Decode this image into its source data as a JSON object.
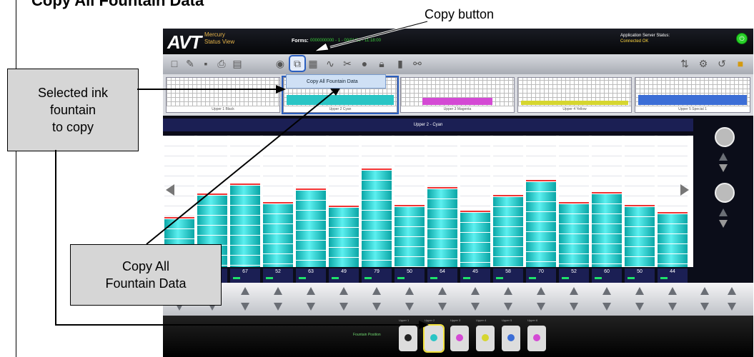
{
  "doc": {
    "title": "Copy All Fountain Data",
    "copy_button_caption": "Copy button",
    "callout_selected": [
      "Selected ink",
      "fountain",
      "to copy"
    ],
    "callout_copy_all": [
      "Copy All",
      "Fountain Data"
    ]
  },
  "app": {
    "logo": "AVT",
    "app_name": [
      "Mercury",
      "Status View"
    ],
    "forms_label": "Forms:",
    "forms_value": "0000000000 - 1 - 00/01/26 - 11:18:00",
    "server_status_label": "Application Server Status:",
    "server_status_value": "Connected OK",
    "toolbar_icons": [
      "new-icon",
      "edit-icon",
      "save-icon",
      "print-icon",
      "open-icon",
      "globe-icon",
      "copy-icon",
      "paste-icon",
      "curve-icon",
      "tools-icon",
      "color-icon",
      "lock-icon",
      "chart-icon",
      "link-icon",
      "scale-icon",
      "adjust-icon",
      "reset-icon",
      "lock-icon"
    ],
    "copy_menu_item": "Copy All Fountain Data",
    "mini_labels": [
      "Upper 1 Black",
      "Upper 2 Cyan",
      "Upper 3 Magenta",
      "Upper 4 Yellow",
      "Upper 5 Special 1"
    ],
    "mini_colors": [
      "#dddddd",
      "#2ac5c5",
      "#d44ad4",
      "#d6d630",
      "#3c6ed6"
    ],
    "header": "Upper 2 - Cyan",
    "zones": [
      40,
      59,
      67,
      52,
      63,
      49,
      79,
      50,
      64,
      45,
      58,
      70,
      52,
      60,
      50,
      44
    ],
    "zone_labels": [
      "40",
      "59",
      "67",
      "52",
      "63",
      "49",
      "79",
      "50",
      "64",
      "45",
      "58",
      "70",
      "52",
      "60",
      "50",
      "44"
    ],
    "press_label": "Fountain Position",
    "units": [
      {
        "label": "Upper 1",
        "color": "#222222"
      },
      {
        "label": "Upper 2",
        "color": "#2ac5c5"
      },
      {
        "label": "Upper 3",
        "color": "#d44ad4"
      },
      {
        "label": "Upper 4",
        "color": "#d6d630"
      },
      {
        "label": "Upper 5",
        "color": "#3c6ed6"
      },
      {
        "label": "Upper 6",
        "color": "#d44ad4"
      }
    ]
  }
}
